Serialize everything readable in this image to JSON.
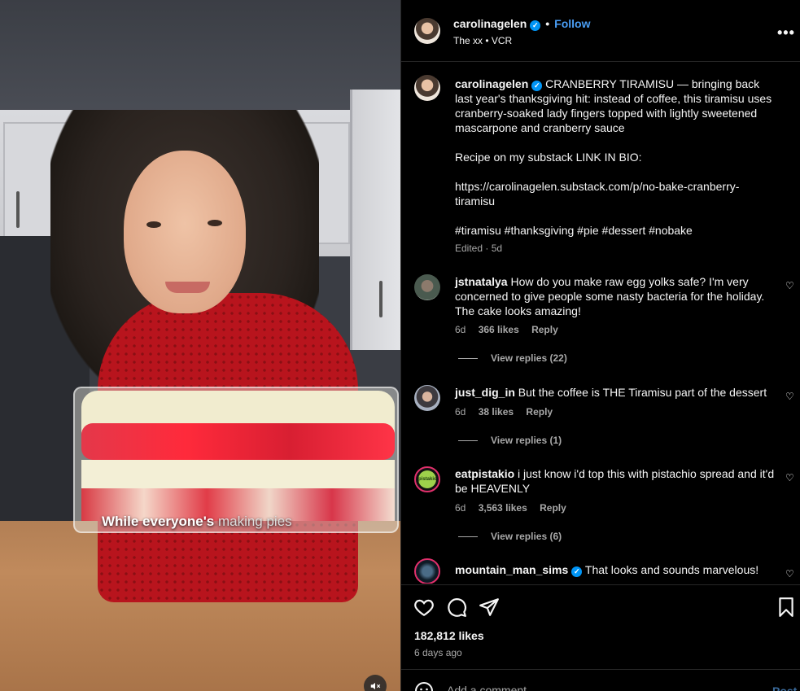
{
  "video": {
    "caption_bold": "While everyone's",
    "caption_rest": "making pies"
  },
  "header": {
    "username": "carolinagelen",
    "separator": "•",
    "follow_label": "Follow",
    "audio": "The xx • VCR",
    "more_label": "•••"
  },
  "post_caption": {
    "username": "carolinagelen",
    "text": "CRANBERRY TIRAMISU — bringing back last year's thanksgiving hit: instead of coffee, this tiramisu uses cranberry-soaked lady fingers topped with lightly sweetened mascarpone and cranberry sauce",
    "recipe_line": "Recipe on my substack LINK IN BIO:",
    "link": "https://carolinagelen.substack.com/p/no-bake-cranberry-tiramisu",
    "hashtags": "#tiramisu #thanksgiving #pie #dessert #nobake",
    "meta": "Edited · 5d"
  },
  "comments": [
    {
      "username": "jstnatalya",
      "text": "How do you make raw egg yolks safe? I'm very concerned to give people some nasty bacteria for the holiday. The cake looks amazing!",
      "age": "6d",
      "likes": "366 likes",
      "reply": "Reply",
      "view_replies": "View replies (22)"
    },
    {
      "username": "just_dig_in",
      "text": "But the coffee is THE Tiramisu part of the dessert",
      "age": "6d",
      "likes": "38 likes",
      "reply": "Reply",
      "view_replies": "View replies (1)"
    },
    {
      "username": "eatpistakio",
      "avatar_text": "pistakio",
      "text": "i just know i'd top this with pistachio spread and it'd be HEAVENLY",
      "age": "6d",
      "likes": "3,563 likes",
      "reply": "Reply",
      "view_replies": "View replies (6)"
    },
    {
      "username": "mountain_man_sims",
      "text": "That looks and sounds marvelous!"
    }
  ],
  "actions": {
    "likes": "182,812 likes",
    "time_ago": "6 days ago",
    "add_comment_placeholder": "Add a comment...",
    "post_label": "Post"
  },
  "icons": {
    "like": "heart-icon",
    "comment": "comment-icon",
    "share": "share-icon",
    "save": "bookmark-icon",
    "emoji": "emoji-icon",
    "mute": "speaker-muted-icon"
  },
  "colors": {
    "accent": "#0095f6",
    "follow": "#4a9ef5",
    "background": "#000000",
    "muted_text": "#a8a8a8"
  }
}
